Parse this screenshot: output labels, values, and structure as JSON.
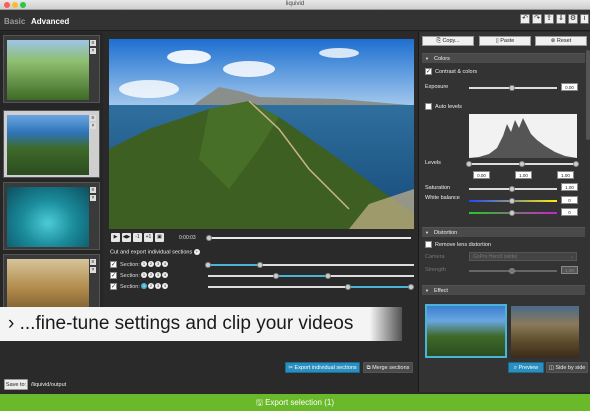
{
  "window": {
    "title": "liquivid"
  },
  "header": {
    "tabs": [
      {
        "label": "Basic"
      },
      {
        "label": "Advanced"
      }
    ],
    "tools": [
      "undo-icon",
      "redo-icon",
      "share-icon",
      "import-icon",
      "export-icon",
      "settings-icon",
      "info-icon"
    ]
  },
  "player": {
    "time": "0:00:03",
    "buttons": [
      "▶",
      "◀▶",
      "-1",
      "+1",
      "▣"
    ],
    "progress": 0.0
  },
  "sections": {
    "label": "Cut and export individual sections",
    "rows": [
      {
        "label": "Section:",
        "numbers": [
          "1",
          "2",
          "3",
          "4"
        ],
        "checked": true
      },
      {
        "label": "Section:",
        "numbers": [
          "1",
          "2",
          "3",
          "4"
        ],
        "checked": true
      },
      {
        "label": "Section:",
        "numbers": [
          "1",
          "2",
          "3",
          "4"
        ],
        "checked": true
      }
    ]
  },
  "banner": {
    "text": "› ...fine-tune settings and clip your videos"
  },
  "bottom": {
    "export_sections": "Export individual sections",
    "merge_sections": "Merge sections",
    "save_to": "Save to:",
    "save_path": "/liquivid/output",
    "export_selection": "Export selection (1)"
  },
  "right_panel": {
    "copy": "Copy...",
    "paste": "Paste",
    "reset": "Reset",
    "colors": {
      "title": "Colors",
      "contrast": "Contrast & colors",
      "exposure_label": "Exposure",
      "exposure_value": "0.00",
      "auto_levels": "Auto levels",
      "levels_label": "Levels",
      "levels_values": [
        "0.00",
        "1.00",
        "1.00"
      ],
      "saturation_label": "Saturation",
      "saturation_value": "1.00",
      "white_balance_label": "White balance",
      "white_balance_values": [
        "0",
        "0"
      ]
    },
    "distortion": {
      "title": "Distortion",
      "remove": "Remove lens distortion",
      "camera_label": "Camera",
      "camera_value": "GoPro Hero3 (wide)",
      "strength_label": "Strength",
      "strength_value": "1.00"
    },
    "effect": {
      "title": "Effect",
      "preview": "Preview",
      "side_by_side": "Side by side"
    }
  },
  "colors": {
    "accent": "#2a8fbf",
    "export_green": "#6ab92a",
    "highlight": "#4ab3d8"
  }
}
